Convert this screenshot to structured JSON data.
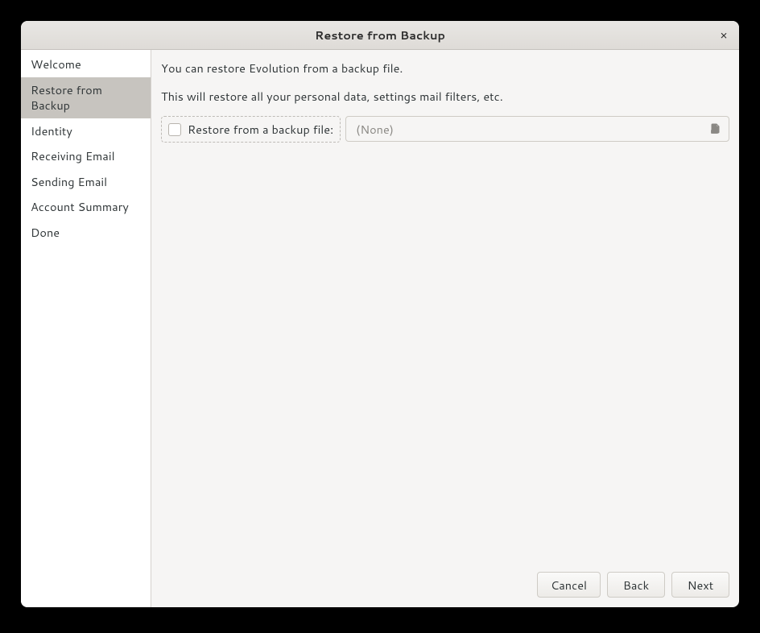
{
  "title": "Restore from Backup",
  "sidebar": {
    "items": [
      {
        "label": "Welcome"
      },
      {
        "label": "Restore from Backup"
      },
      {
        "label": "Identity"
      },
      {
        "label": "Receiving Email"
      },
      {
        "label": "Sending Email"
      },
      {
        "label": "Account Summary"
      },
      {
        "label": "Done"
      }
    ],
    "active_index": 1
  },
  "content": {
    "line1": "You can restore Evolution from a backup file.",
    "line2": "This will restore all your personal data, settings mail filters, etc.",
    "checkbox_label": "Restore from a backup file:",
    "file_placeholder": "(None)"
  },
  "buttons": {
    "cancel": "Cancel",
    "back": "Back",
    "next": "Next"
  },
  "close_icon_glyph": "×"
}
